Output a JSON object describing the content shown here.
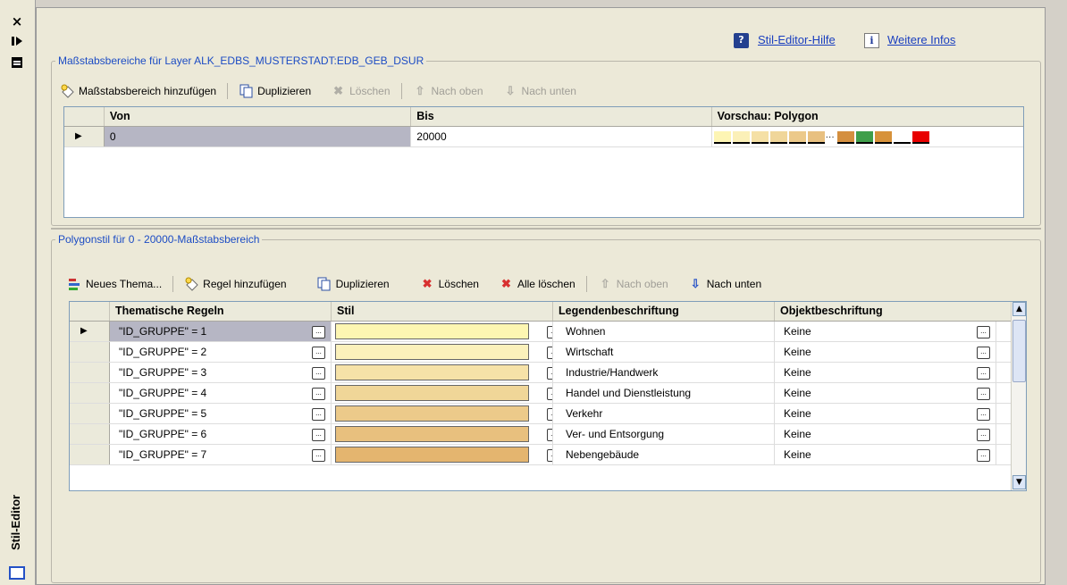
{
  "panel": {
    "close_glyph": "×",
    "title": "Stil-Editor",
    "help_label": "Stil-Editor-Hilfe",
    "info_label": "Weitere Infos",
    "help_icon": "question-icon",
    "info_icon": "info-icon"
  },
  "scale_section": {
    "legend": "Maßstabsbereiche für Layer ALK_EDBS_MUSTERSTADT:EDB_GEB_DSUR",
    "toolbar": {
      "add": "Maßstabsbereich hinzufügen",
      "duplicate": "Duplizieren",
      "delete": "Löschen",
      "up": "Nach oben",
      "down": "Nach unten"
    },
    "columns": [
      "Von",
      "Bis",
      "Vorschau: Polygon"
    ],
    "rows": [
      {
        "von": "0",
        "bis": "20000",
        "preview_dots": "···"
      }
    ],
    "preview_colors": [
      "#fdf5b4",
      "#fbf0b8",
      "#f5e0a6",
      "#f0d69a",
      "#ecc98a",
      "#e8c080",
      "#d48f3f",
      "#3f9e4a",
      "#d7923a",
      "#ffffff",
      "#e80000"
    ]
  },
  "style_section": {
    "legend": "Polygonstil für 0 - 20000-Maßstabsbereich",
    "toolbar": {
      "new_theme": "Neues Thema...",
      "add_rule": "Regel hinzufügen",
      "duplicate": "Duplizieren",
      "delete": "Löschen",
      "delete_all": "Alle löschen",
      "up": "Nach oben",
      "down": "Nach unten"
    },
    "columns": [
      "Thematische Regeln",
      "Stil",
      "Legendenbeschriftung",
      "Objektbeschriftung"
    ],
    "rows": [
      {
        "rule": "\"ID_GRUPPE\" = 1",
        "color": "#fdf6b2",
        "legend": "Wohnen",
        "label": "Keine"
      },
      {
        "rule": "\"ID_GRUPPE\" = 2",
        "color": "#fbf1bb",
        "legend": "Wirtschaft",
        "label": "Keine"
      },
      {
        "rule": "\"ID_GRUPPE\" = 3",
        "color": "#f6e2a8",
        "legend": "Industrie/Handwerk",
        "label": "Keine"
      },
      {
        "rule": "\"ID_GRUPPE\" = 4",
        "color": "#f0d698",
        "legend": "Handel und Dienstleistung",
        "label": "Keine"
      },
      {
        "rule": "\"ID_GRUPPE\" = 5",
        "color": "#ecca8a",
        "legend": "Verkehr",
        "label": "Keine"
      },
      {
        "rule": "\"ID_GRUPPE\" = 6",
        "color": "#e8c07e",
        "legend": "Ver- und Entsorgung",
        "label": "Keine"
      },
      {
        "rule": "\"ID_GRUPPE\" = 7",
        "color": "#e4b56f",
        "legend": "Nebengebäude",
        "label": "Keine"
      }
    ]
  }
}
